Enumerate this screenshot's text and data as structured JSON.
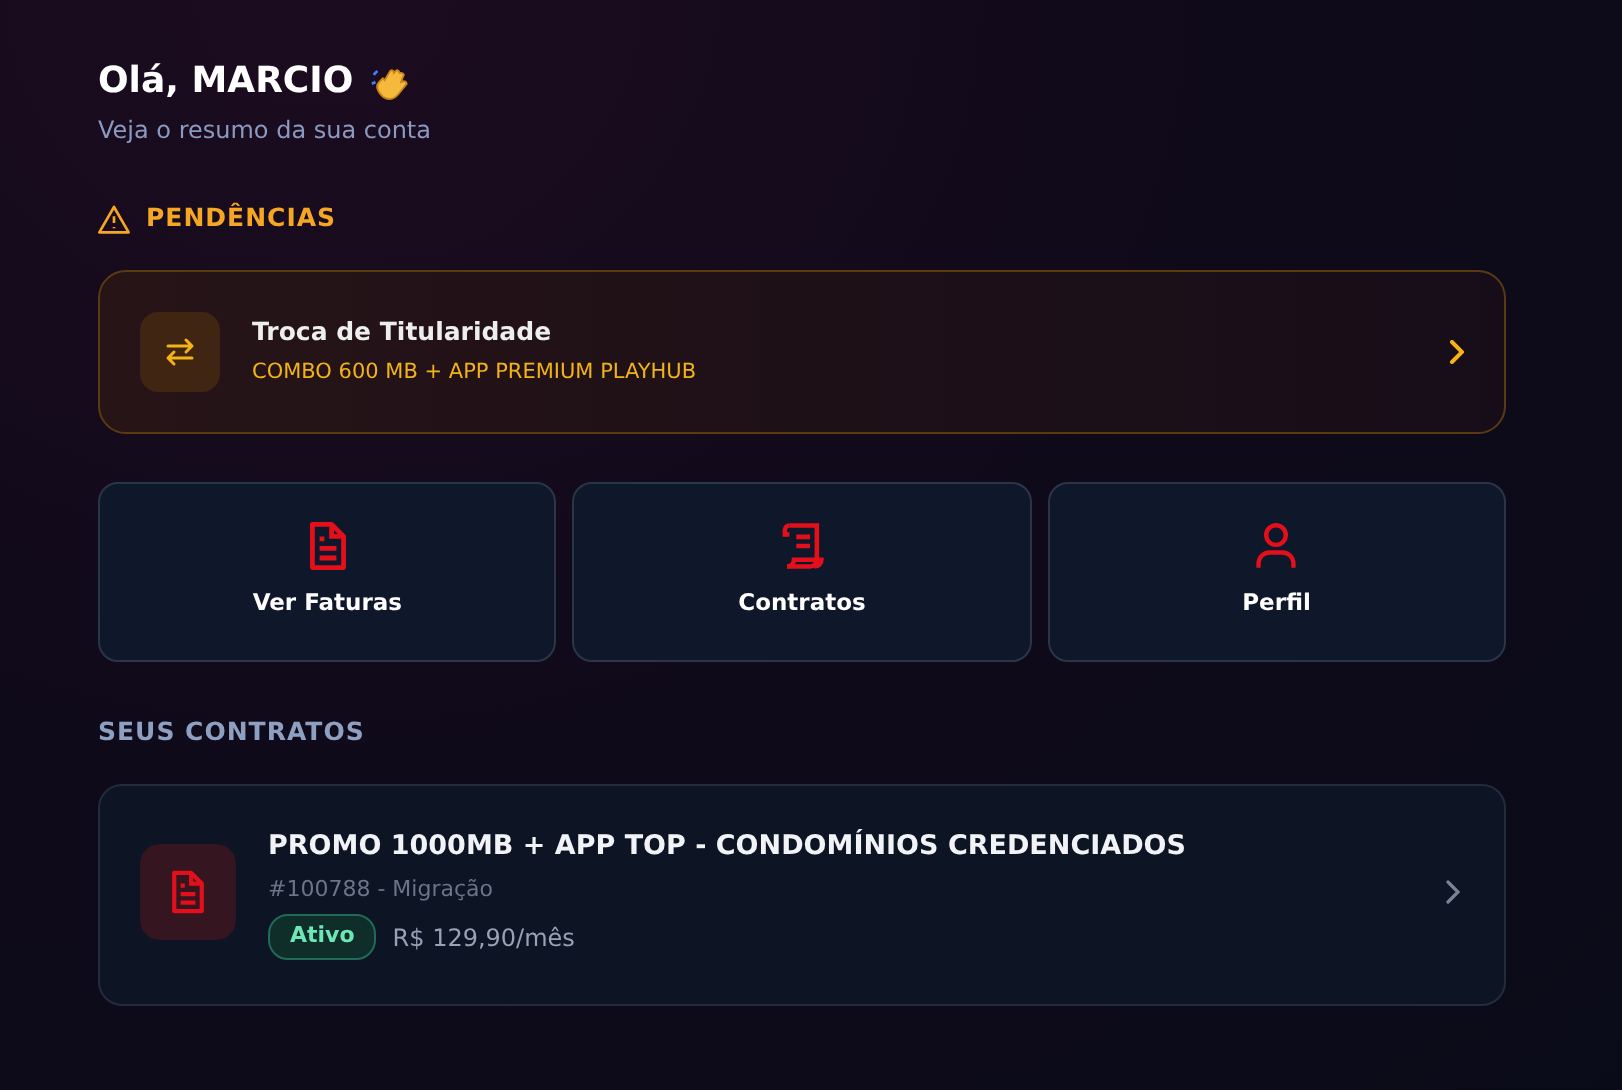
{
  "greeting": {
    "title": "Olá, MARCIO",
    "subtitle": "Veja o resumo da sua conta"
  },
  "pending": {
    "heading": "PENDÊNCIAS",
    "items": [
      {
        "title": "Troca de Titularidade",
        "subtitle": "COMBO 600 MB + APP PREMIUM PLAYHUB"
      }
    ]
  },
  "shortcuts": [
    {
      "kind": "invoices",
      "label": "Ver Faturas"
    },
    {
      "kind": "contracts",
      "label": "Contratos"
    },
    {
      "kind": "profile",
      "label": "Perfil"
    }
  ],
  "contracts": {
    "heading": "SEUS CONTRATOS",
    "items": [
      {
        "title": "PROMO 1000MB + APP TOP - CONDOMÍNIOS CREDENCIADOS",
        "meta": "#100788 - Migração",
        "status": "Ativo",
        "price": "R$ 129,90/mês"
      }
    ]
  }
}
